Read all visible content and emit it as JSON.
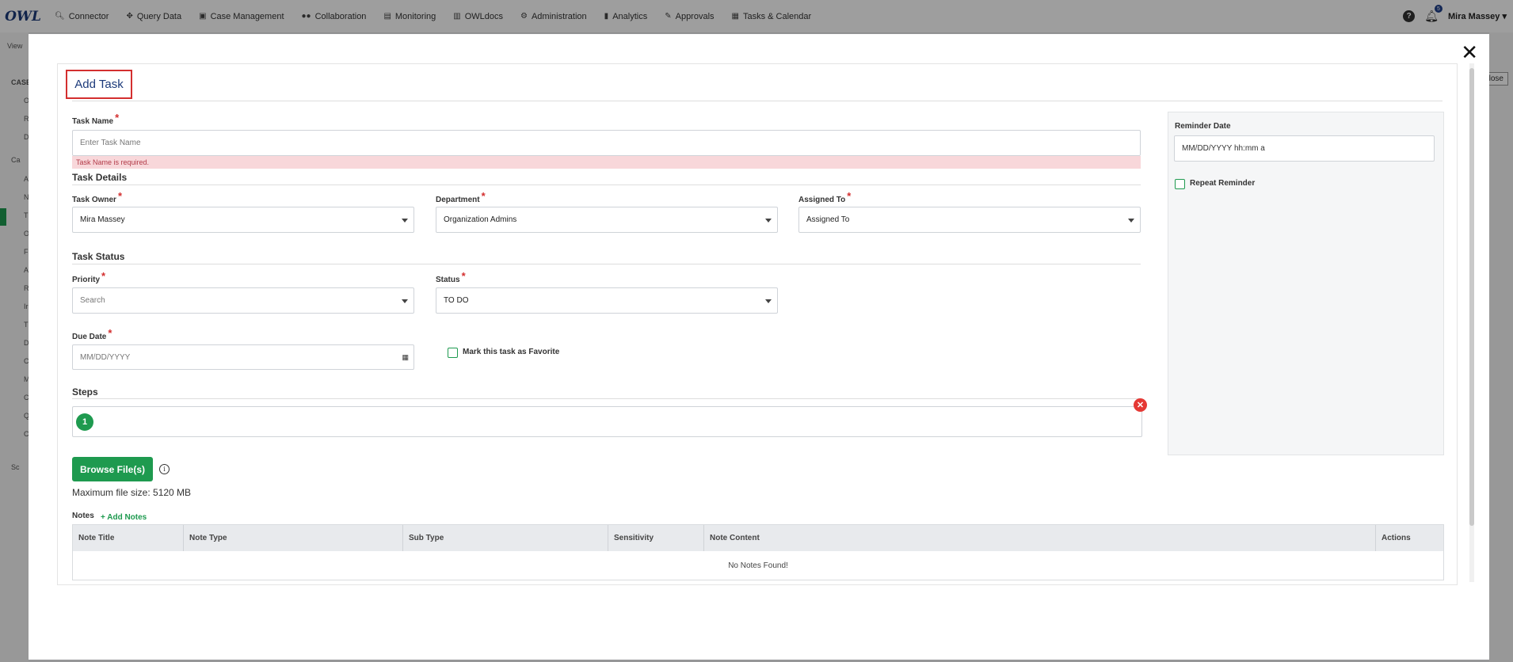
{
  "nav": {
    "logo": "OWL",
    "items": [
      {
        "label": "Connector",
        "icon": "search-icon"
      },
      {
        "label": "Query Data",
        "icon": "move-icon"
      },
      {
        "label": "Case Management",
        "icon": "briefcase-icon"
      },
      {
        "label": "Collaboration",
        "icon": "users-icon"
      },
      {
        "label": "Monitoring",
        "icon": "monitor-icon"
      },
      {
        "label": "OWLdocs",
        "icon": "doc-icon"
      },
      {
        "label": "Administration",
        "icon": "gears-icon"
      },
      {
        "label": "Analytics",
        "icon": "file-icon"
      },
      {
        "label": "Approvals",
        "icon": "approval-icon"
      },
      {
        "label": "Tasks & Calendar",
        "icon": "calendar-icon"
      }
    ],
    "notification_count": "5",
    "user": "Mira Massey"
  },
  "background": {
    "view_label": "View",
    "close_label": "lose",
    "sidebar_letters": [
      "CASE",
      "O",
      "R",
      "D",
      "Ca",
      "A",
      "N",
      "T",
      "O",
      "F",
      "A",
      "R",
      "Ir",
      "T",
      "D",
      "C",
      "M",
      "C",
      "Q",
      "C",
      "Sc"
    ]
  },
  "modal": {
    "title": "Add Task",
    "task_name": {
      "label": "Task Name",
      "placeholder": "Enter Task Name",
      "error": "Task Name is required."
    },
    "task_details_title": "Task Details",
    "task_owner": {
      "label": "Task Owner",
      "value": "Mira Massey"
    },
    "department": {
      "label": "Department",
      "value": "Organization Admins"
    },
    "assigned_to": {
      "label": "Assigned To",
      "value": "Assigned To"
    },
    "task_status_title": "Task Status",
    "priority": {
      "label": "Priority",
      "placeholder": "Search"
    },
    "status": {
      "label": "Status",
      "value": "TO DO"
    },
    "due_date": {
      "label": "Due Date",
      "placeholder": "MM/DD/YYYY"
    },
    "favorite_label": "Mark this task as Favorite",
    "steps_title": "Steps",
    "step_number": "1",
    "browse_label": "Browse File(s)",
    "max_size": "Maximum file size: 5120 MB",
    "notes": {
      "label": "Notes",
      "add_label": "+ Add Notes",
      "columns": [
        "Note Title",
        "Note Type",
        "Sub Type",
        "Sensitivity",
        "Note Content",
        "Actions"
      ],
      "empty_text": "No Notes Found!"
    },
    "reminder": {
      "label": "Reminder Date",
      "placeholder": "MM/DD/YYYY hh:mm a",
      "repeat_label": "Repeat Reminder"
    }
  }
}
